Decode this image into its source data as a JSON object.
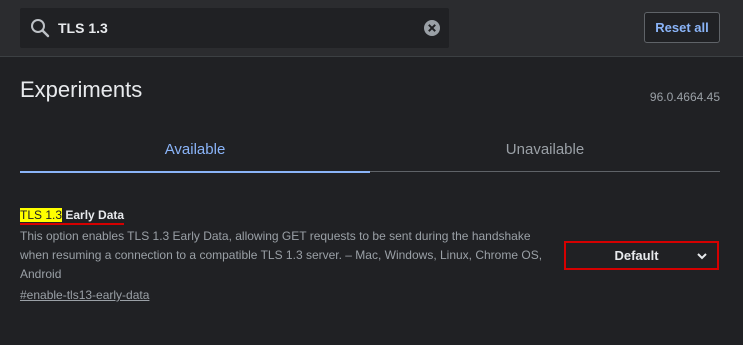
{
  "search": {
    "value": "TLS 1.3",
    "icon": "search-icon",
    "clear_icon": "clear-icon"
  },
  "header": {
    "reset_label": "Reset all"
  },
  "page": {
    "title": "Experiments",
    "version": "96.0.4664.45"
  },
  "tabs": [
    {
      "label": "Available",
      "active": true
    },
    {
      "label": "Unavailable",
      "active": false
    }
  ],
  "experiment": {
    "title_highlight": "TLS 1.3",
    "title_rest": " Early Data",
    "description": "This option enables TLS 1.3 Early Data, allowing GET requests to be sent during the handshake when resuming a connection to a compatible TLS 1.3 server. – Mac, Windows, Linux, Chrome OS, Android",
    "link": "#enable-tls13-early-data",
    "selected_option": "Default"
  },
  "colors": {
    "background": "#202124",
    "header": "#2b2c2f",
    "accent": "#8ab4f8",
    "highlight": "#ffff00",
    "annotation_red": "#d50000"
  }
}
